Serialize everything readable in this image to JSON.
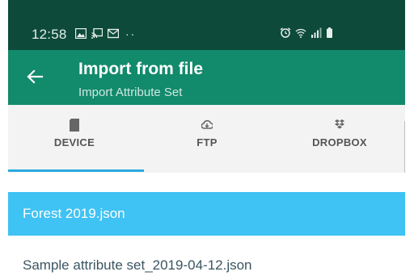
{
  "status_bar": {
    "time": "12:58",
    "dots": "··",
    "left_icons": [
      "image-icon",
      "cast-icon",
      "mail-icon"
    ],
    "right_icons": [
      "alarm-icon",
      "wifi-icon",
      "signal-icon",
      "battery-icon"
    ]
  },
  "app_bar": {
    "title": "Import from file",
    "subtitle": "Import Attribute Set",
    "back_icon": "arrow-left-icon"
  },
  "tabs": [
    {
      "label": "DEVICE",
      "icon": "sd-card-icon",
      "selected": true
    },
    {
      "label": "FTP",
      "icon": "cloud-download-icon",
      "selected": false
    },
    {
      "label": "DROPBOX",
      "icon": "dropbox-icon",
      "selected": false
    }
  ],
  "files": [
    {
      "name": "Forest 2019.json",
      "selected": true
    },
    {
      "name": "Sample attribute set_2019-04-12.json",
      "selected": false
    }
  ],
  "colors": {
    "status_bar": "#0d4a3a",
    "app_bar": "#128a6c",
    "tab_bar": "#f3f3f3",
    "tab_indicator": "#2aaae3",
    "selected_row": "#3fc2f4",
    "file_text": "#3b5561"
  }
}
